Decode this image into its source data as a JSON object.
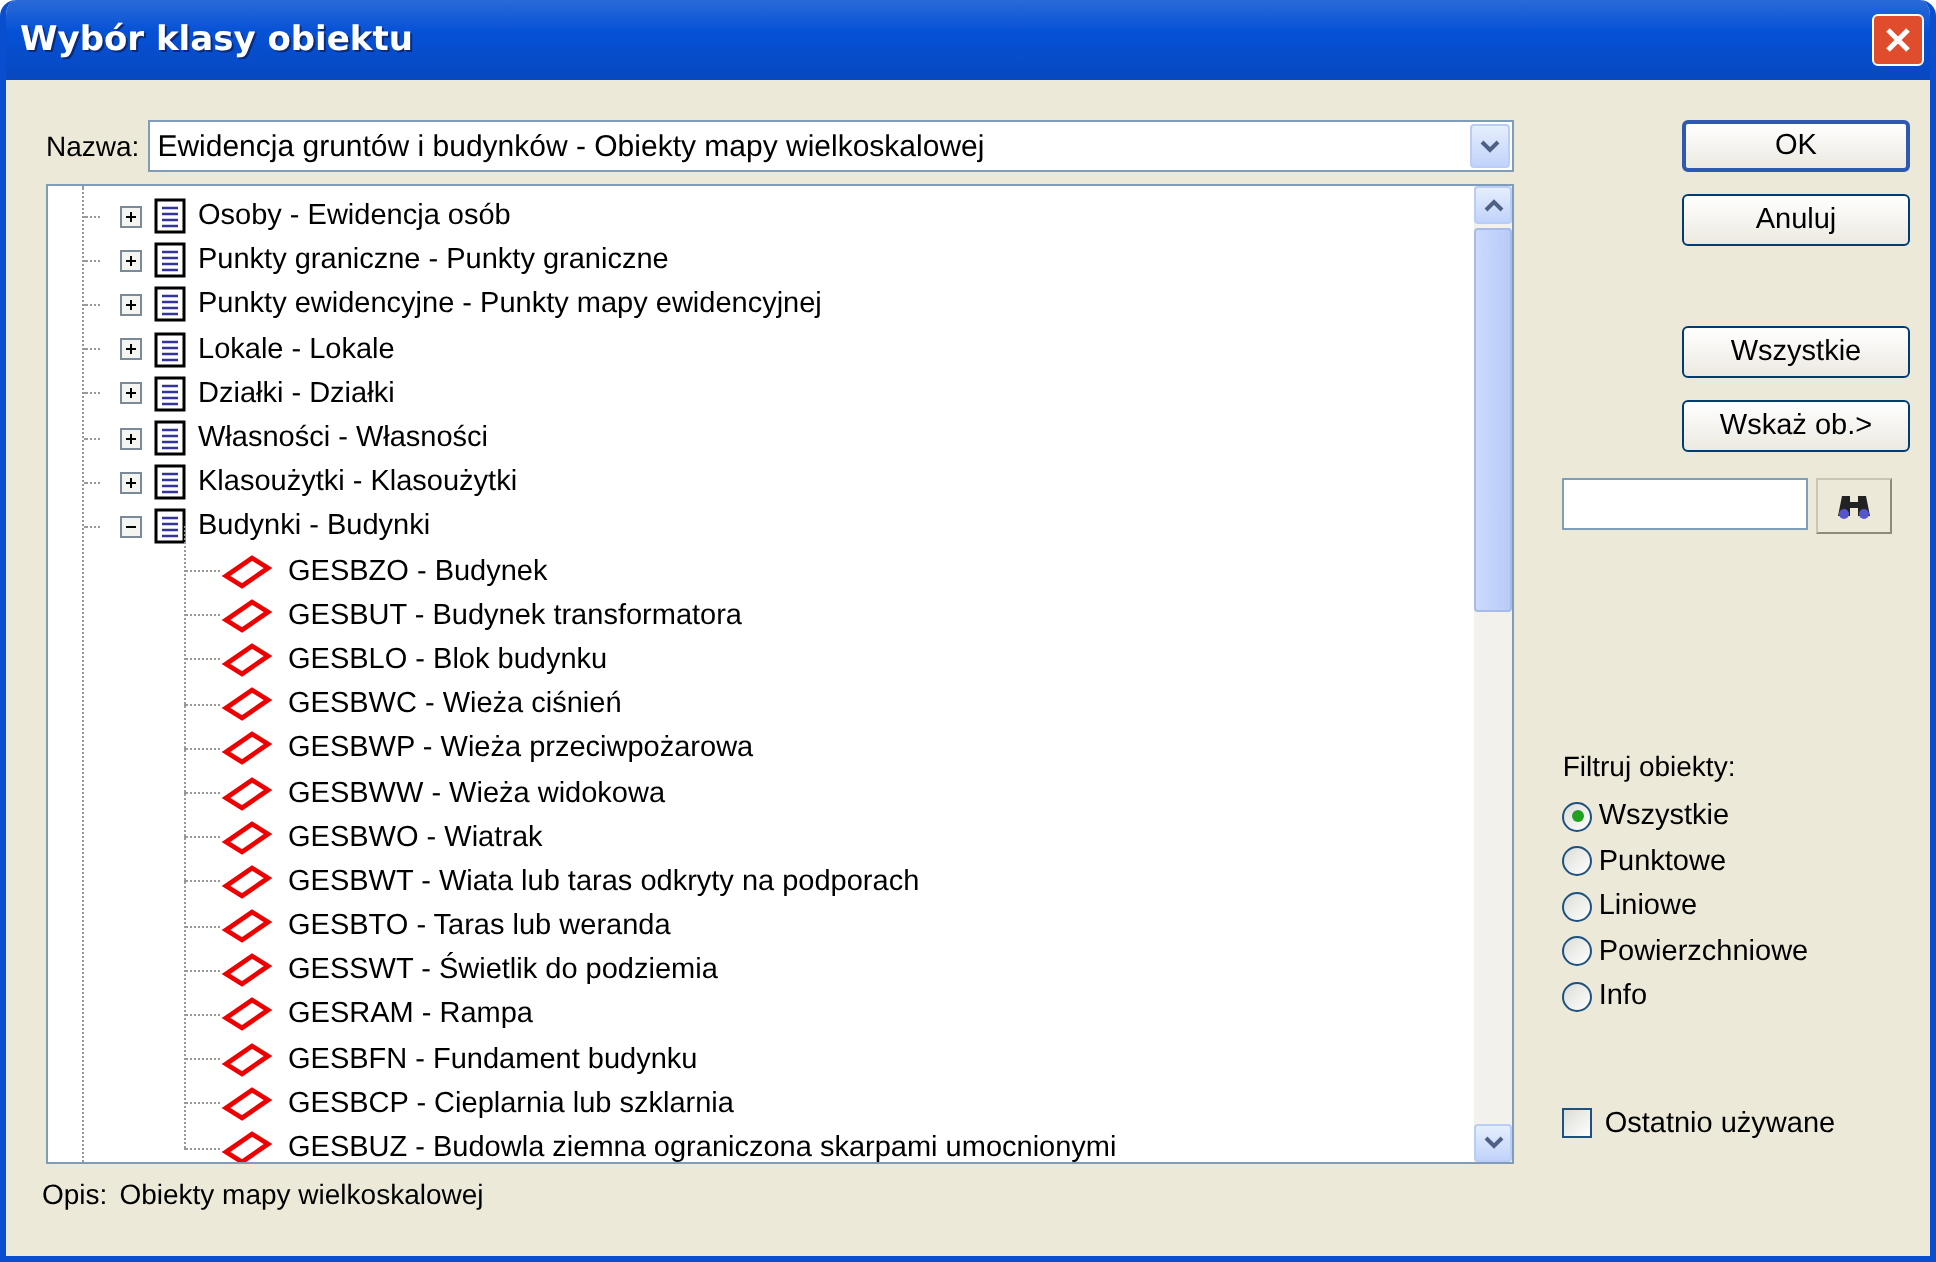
{
  "window": {
    "title": "Wybór klasy obiektu"
  },
  "name_field": {
    "label": "Nazwa:",
    "value": "Ewidencja gruntów i budynków - Obiekty mapy wielkoskalowej"
  },
  "tree": [
    {
      "label": "Osoby - Ewidencja osób",
      "expanded": false
    },
    {
      "label": "Punkty graniczne - Punkty graniczne",
      "expanded": false
    },
    {
      "label": "Punkty ewidencyjne - Punkty mapy ewidencyjnej",
      "expanded": false
    },
    {
      "label": "Lokale - Lokale",
      "expanded": false
    },
    {
      "label": "Działki - Działki",
      "expanded": false
    },
    {
      "label": "Własności - Własności",
      "expanded": false
    },
    {
      "label": "Klasoużytki - Klasoużytki",
      "expanded": false
    },
    {
      "label": "Budynki - Budynki",
      "expanded": true,
      "children": [
        {
          "label": "GESBZO - Budynek"
        },
        {
          "label": "GESBUT - Budynek transformatora"
        },
        {
          "label": "GESBLO - Blok budynku"
        },
        {
          "label": "GESBWC - Wieża ciśnień"
        },
        {
          "label": "GESBWP - Wieża przeciwpożarowa"
        },
        {
          "label": "GESBWW - Wieża widokowa"
        },
        {
          "label": "GESBWO - Wiatrak"
        },
        {
          "label": "GESBWT - Wiata lub taras odkryty na podporach"
        },
        {
          "label": "GESBTO - Taras lub weranda"
        },
        {
          "label": "GESSWT - Świetlik do podziemia"
        },
        {
          "label": "GESRAM - Rampa"
        },
        {
          "label": "GESBFN - Fundament budynku"
        },
        {
          "label": "GESBCP - Cieplarnia lub szklarnia"
        },
        {
          "label": "GESBUZ - Budowla ziemna ograniczona skarpami umocnionymi"
        }
      ]
    }
  ],
  "description": {
    "label": "Opis:",
    "value": "Obiekty mapy wielkoskalowej"
  },
  "buttons": [
    {
      "label": "OK",
      "default": true
    },
    {
      "label": "Anuluj",
      "default": false
    }
  ],
  "side_buttons": [
    {
      "label": "Wszystkie"
    },
    {
      "label": "Wskaż ob.>"
    }
  ],
  "filter": {
    "label": "Filtruj obiekty:",
    "options": [
      {
        "label": "Wszystkie",
        "selected": true
      },
      {
        "label": "Punktowe",
        "selected": false
      },
      {
        "label": "Liniowe",
        "selected": false
      },
      {
        "label": "Powierzchniowe",
        "selected": false
      },
      {
        "label": "Info",
        "selected": false
      }
    ]
  },
  "recent_checkbox": {
    "label": "Ostatnio używane",
    "checked": false
  }
}
